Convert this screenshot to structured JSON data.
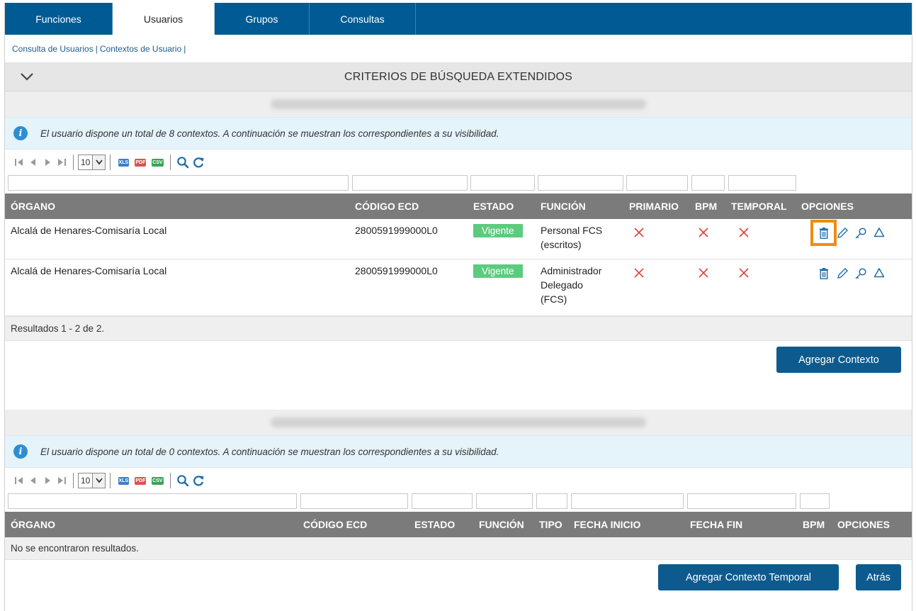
{
  "tabs": [
    "Funciones",
    "Usuarios",
    "Grupos",
    "Consultas"
  ],
  "active_tab": "Usuarios",
  "subnav": {
    "link1": "Consulta de Usuarios",
    "sep1": "|",
    "link2": "Contextos de Usuario",
    "sep2": "|"
  },
  "criteria": {
    "title": "CRITERIOS DE BÚSQUEDA EXTENDIDOS"
  },
  "section1": {
    "info": "El usuario dispone un total de 8 contextos. A continuación se muestran los correspondientes a su visibilidad.",
    "page_size": "10",
    "columns": {
      "organo": "ÓRGANO",
      "codigo": "CÓDIGO ECD",
      "estado": "ESTADO",
      "funcion": "FUNCIÓN",
      "primario": "PRIMARIO",
      "bpm": "BPM",
      "temporal": "TEMPORAL",
      "opciones": "OPCIONES"
    },
    "rows": [
      {
        "organo": "Alcalá de Henares-Comisaría Local",
        "codigo": "2800591999000L0",
        "estado": "Vigente",
        "funcion_l1": "Personal FCS",
        "funcion_l2": "(escritos)",
        "funcion_l3": ""
      },
      {
        "organo": "Alcalá de Henares-Comisaría Local",
        "codigo": "2800591999000L0",
        "estado": "Vigente",
        "funcion_l1": "Administrador",
        "funcion_l2": "Delegado",
        "funcion_l3": "(FCS)"
      }
    ],
    "results": "Resultados 1 - 2 de 2.",
    "add_button": "Agregar Contexto"
  },
  "section2": {
    "info": "El usuario dispone un total de 0 contextos. A continuación se muestran los correspondientes a su visibilidad.",
    "page_size": "10",
    "columns": {
      "organo": "ÓRGANO",
      "codigo": "CÓDIGO ECD",
      "estado": "ESTADO",
      "funcion": "FUNCIÓN",
      "tipo": "TIPO",
      "fecha_inicio": "FECHA INICIO",
      "fecha_fin": "FECHA FIN",
      "bpm": "BPM",
      "opciones": "OPCIONES"
    },
    "empty": "No se encontraron resultados.",
    "add_temp_button": "Agregar Contexto Temporal",
    "back_button": "Atrás"
  },
  "export_labels": {
    "xls": "XLS",
    "pdf": "PDF",
    "csv": "CSV"
  },
  "colors": {
    "primary": "#005b94",
    "button": "#0d5b8e",
    "badge": "#5dcb7e",
    "highlight": "#f08c10",
    "icon": "#1f6fa8",
    "cross": "#e0403c"
  },
  "icons": [
    "trash-icon",
    "pencil-icon",
    "key-icon",
    "recycle-icon",
    "search-icon",
    "refresh-icon",
    "info-icon",
    "chevron-down-icon"
  ]
}
